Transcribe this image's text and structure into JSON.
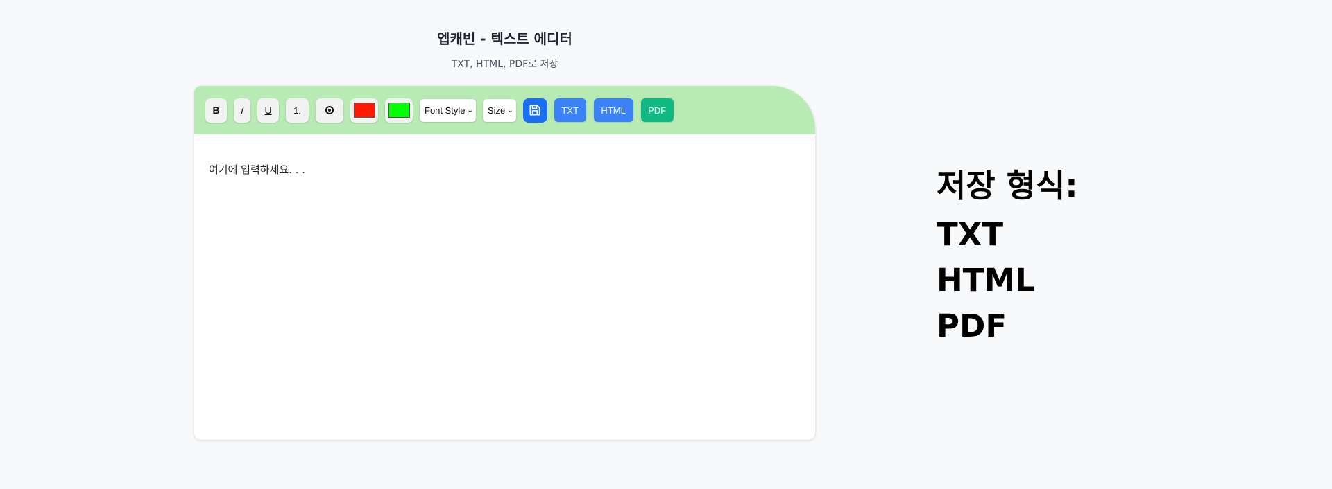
{
  "header": {
    "title": "엡캐빈 - 텍스트 에디터",
    "subtitle": "TXT, HTML, PDF로 저장"
  },
  "toolbar": {
    "bold_label": "B",
    "italic_label": "i",
    "underline_label": "U",
    "ordered_list_label": "1.",
    "text_color": "#ff1a00",
    "highlight_color": "#00ff00",
    "font_style_select": "Font Style",
    "size_select": "Size",
    "txt_label": "TXT",
    "html_label": "HTML",
    "pdf_label": "PDF"
  },
  "editor": {
    "placeholder": "여기에 입력하세요. . ."
  },
  "formats": {
    "title": "저장 형식:",
    "items": [
      "TXT",
      "HTML",
      "PDF"
    ]
  },
  "colors": {
    "toolbar_bg": "#b8ebb4",
    "save_icon_bg": "#1a6ff2",
    "txt_html_bg": "#3b82f6",
    "pdf_bg": "#10b981"
  },
  "icons": {
    "radio": "radio-button-icon",
    "save": "floppy-disk-icon",
    "chevron": "chevron-down-icon"
  }
}
